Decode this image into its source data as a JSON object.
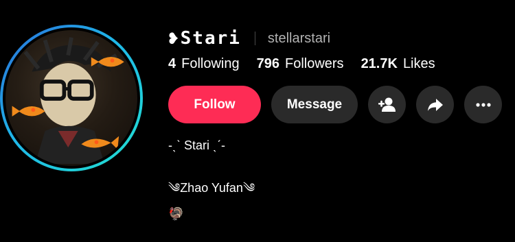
{
  "profile": {
    "display_name": "❥Stari",
    "username": "stellarstari",
    "avatar": {
      "icon": "profile-photo",
      "ring_colors": [
        "#2a6bd8",
        "#1fb7e8",
        "#22e0cf"
      ]
    }
  },
  "stats": [
    {
      "count": "4",
      "label": "Following"
    },
    {
      "count": "796",
      "label": "Followers"
    },
    {
      "count": "21.7K",
      "label": "Likes"
    }
  ],
  "actions": {
    "follow_label": "Follow",
    "message_label": "Message",
    "icons": [
      "add-friend-icon",
      "share-icon",
      "more-icon"
    ],
    "follow_color": "#fe2c55"
  },
  "bio": {
    "line1": "-ˎˋ Stari ˎˊ-",
    "line2": "༄Zhao Yufan༄",
    "line3": "🦃"
  }
}
